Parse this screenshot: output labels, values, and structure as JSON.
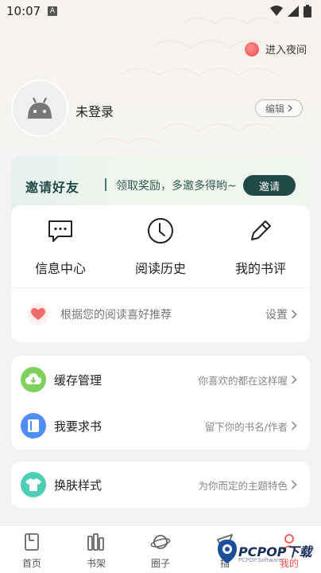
{
  "status_bar": {
    "time": "10:07",
    "notif_badge": "A"
  },
  "night_mode": {
    "label": "进入夜间"
  },
  "profile": {
    "login_text": "未登录",
    "edit_label": "编辑"
  },
  "invite": {
    "title": "邀请好友",
    "subtitle": "领取奖励，多邀多得哟~",
    "button_label": "邀请"
  },
  "quick_actions": [
    {
      "label": "信息中心",
      "icon": "message-icon"
    },
    {
      "label": "阅读历史",
      "icon": "clock-icon"
    },
    {
      "label": "我的书评",
      "icon": "pen-icon"
    }
  ],
  "recommend": {
    "text": "根据您的阅读喜好推荐",
    "setting_label": "设置"
  },
  "menu_group_1": [
    {
      "label": "缓存管理",
      "hint": "你喜欢的都在这样喔",
      "icon": "cloud-download-icon"
    },
    {
      "label": "我要求书",
      "hint": "留下你的书名/作者",
      "icon": "book-request-icon"
    }
  ],
  "menu_group_2": [
    {
      "label": "换肤样式",
      "hint": "为你而定的主题特色",
      "icon": "shirt-icon"
    }
  ],
  "bottom_nav": [
    {
      "label": "首页",
      "icon": "home-book-icon"
    },
    {
      "label": "书架",
      "icon": "bookshelf-icon"
    },
    {
      "label": "圈子",
      "icon": "planet-icon"
    },
    {
      "label": "插",
      "icon": "flag-icon"
    },
    {
      "label": "我的",
      "icon": "profile-icon",
      "active": true
    }
  ],
  "watermark": {
    "text": "PCPOP下载",
    "sub": "PCPOP.Software"
  },
  "colors": {
    "accent": "#f4534a",
    "invite_dark": "#1f4a47",
    "green_icon": "#7fd15e",
    "blue_icon": "#4f8df7",
    "teal_icon": "#4ccfb5"
  }
}
